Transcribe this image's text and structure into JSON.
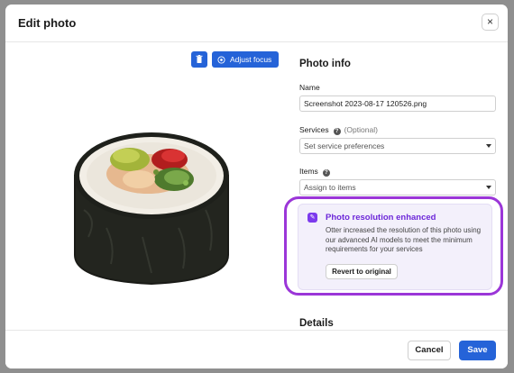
{
  "modal": {
    "title": "Edit photo",
    "close_icon": "×"
  },
  "photo": {
    "delete_icon": "trash-icon",
    "adjust_focus_label": "Adjust focus",
    "image_subject": "sushi-roll"
  },
  "panel": {
    "heading": "Photo info",
    "name": {
      "label": "Name",
      "value": "Screenshot 2023-08-17 120526.png"
    },
    "services": {
      "label": "Services",
      "optional": "(Optional)",
      "placeholder": "Set service preferences"
    },
    "items": {
      "label": "Items",
      "placeholder": "Assign to items"
    },
    "callout": {
      "title": "Photo resolution enhanced",
      "body": "Otter increased the resolution of this photo using our advanced AI models to meet the minimum requirements for your services",
      "revert_label": "Revert to original"
    },
    "details_heading": "Details"
  },
  "footer": {
    "cancel_label": "Cancel",
    "save_label": "Save"
  },
  "colors": {
    "primary": "#2563d8",
    "highlight_outline": "#9b36d8",
    "callout_title": "#6d28d9"
  }
}
